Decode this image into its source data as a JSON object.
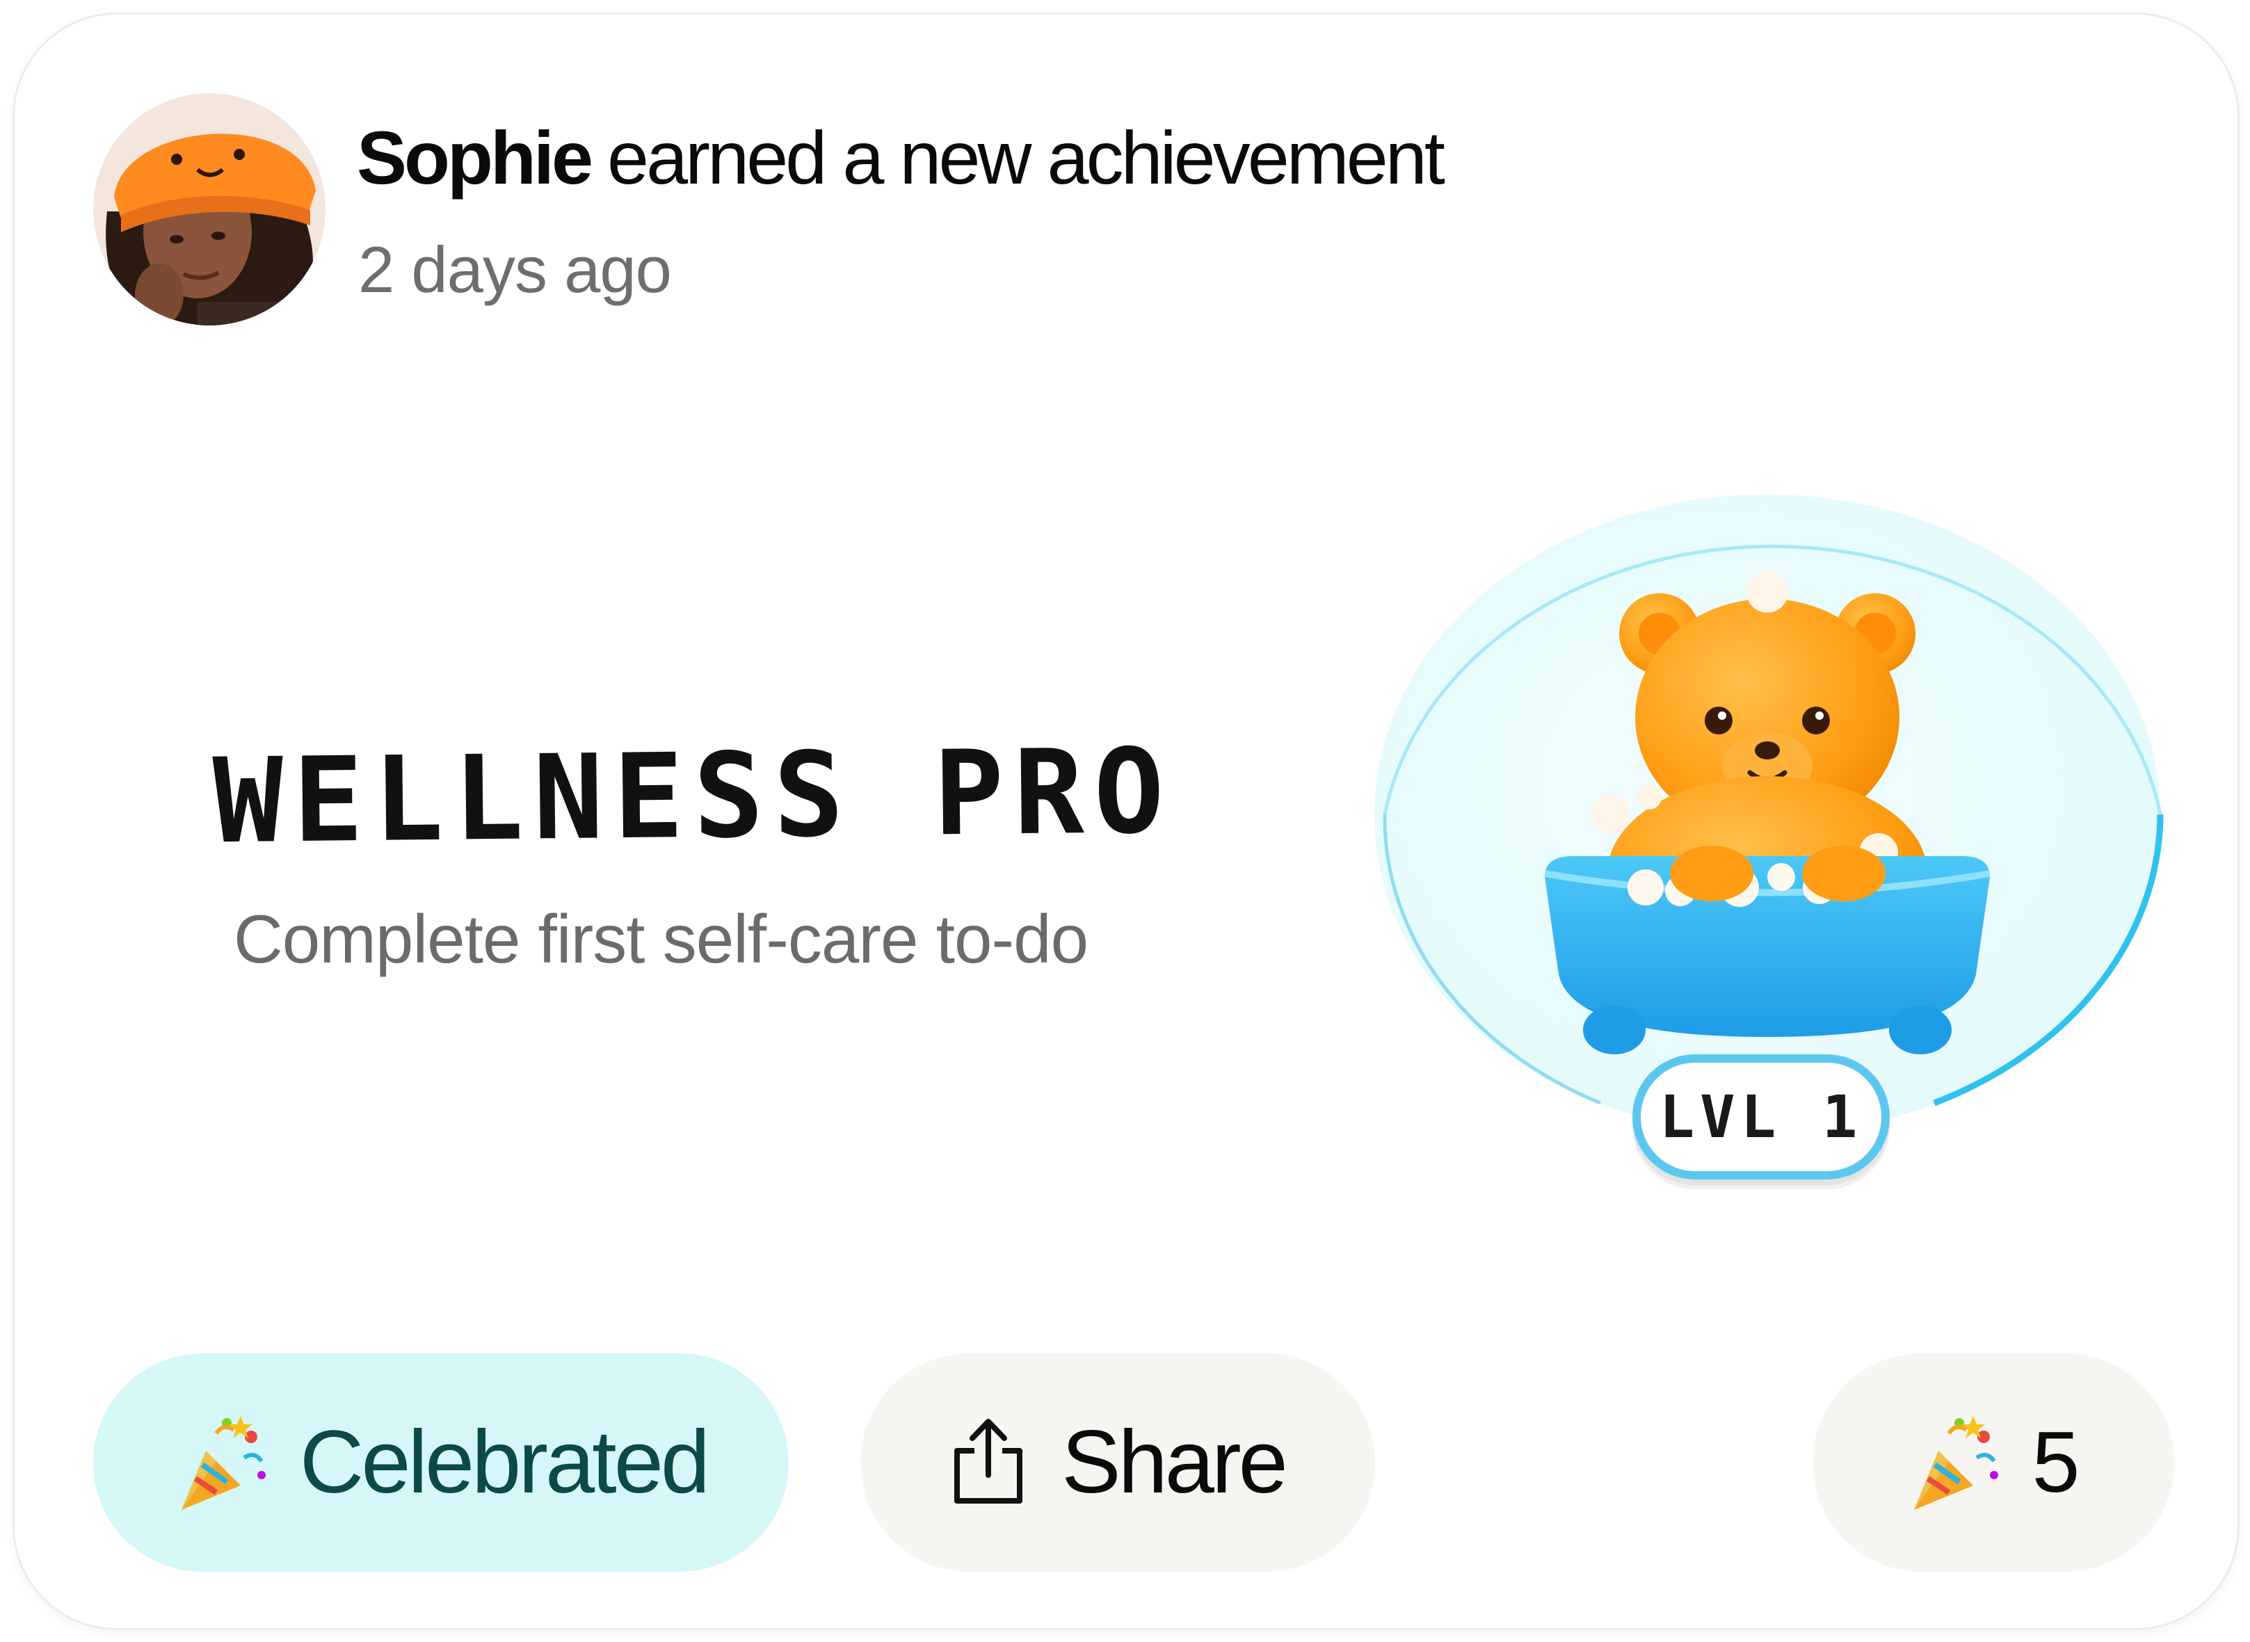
{
  "post": {
    "user_name": "Sophie",
    "action": "earned a new achievement",
    "timestamp": "2 days ago"
  },
  "achievement": {
    "title": "WELLNESS PRO",
    "description": "Complete first self-care to-do",
    "level": "LVL 1",
    "badge_icon": "bear-in-bathtub-icon"
  },
  "actions": {
    "celebrated_label": "Celebrated",
    "celebrated_icon": "party-popper-icon",
    "share_label": "Share",
    "share_icon": "share-icon",
    "celebration_count": "5",
    "celebration_count_icon": "party-popper-icon"
  },
  "colors": {
    "celebrated_bg": "#d5f7f8",
    "celebrated_text": "#0b4a45",
    "neutral_button_bg": "#f7f5f1",
    "badge_circle": "#e9fcfd",
    "badge_outline": "#31c4ee",
    "bear_orange": "#ffa31a",
    "tub_blue": "#28aef0"
  }
}
